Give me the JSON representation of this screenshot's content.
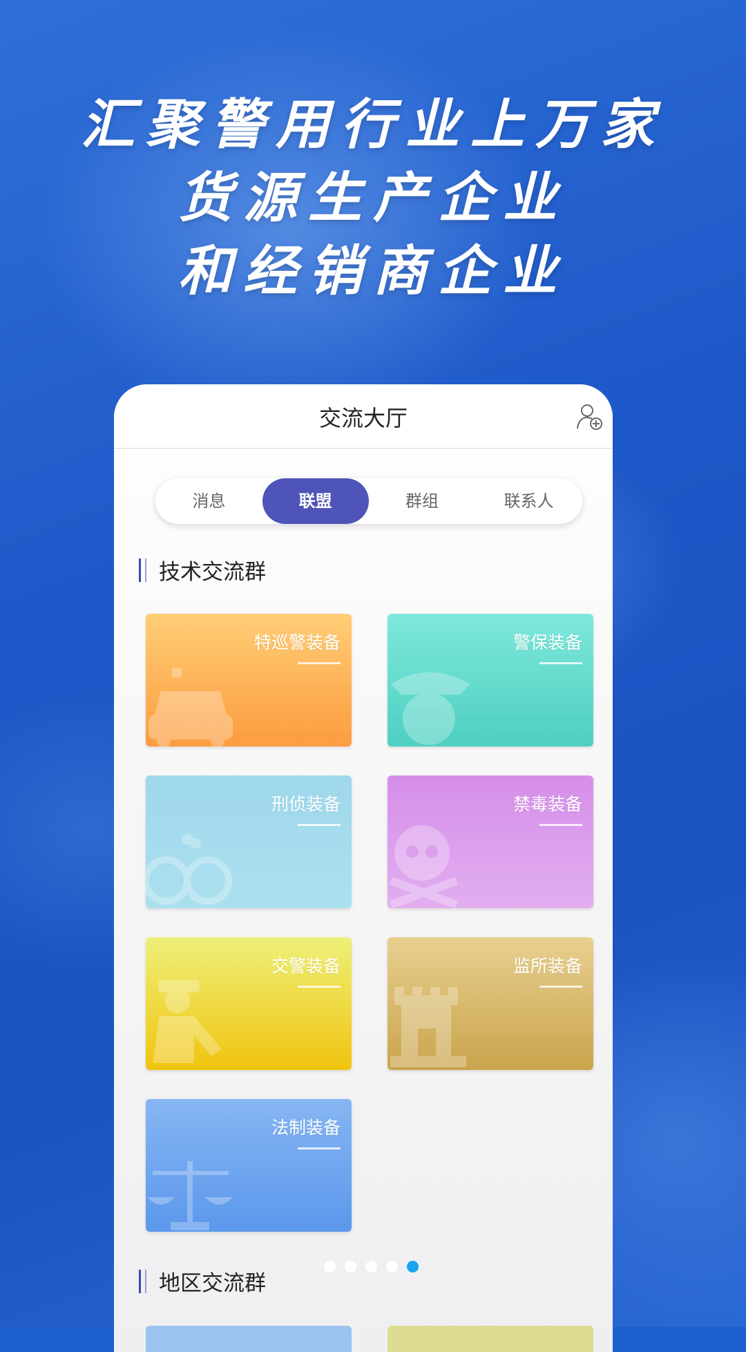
{
  "headline": {
    "line1": "汇聚警用行业上万家",
    "line2": "货源生产企业",
    "line3": "和经销商企业"
  },
  "nav": {
    "title": "交流大厅",
    "add_contact_icon": "add-contact-icon"
  },
  "tabs": [
    {
      "label": "消息",
      "active": false
    },
    {
      "label": "联盟",
      "active": true
    },
    {
      "label": "群组",
      "active": false
    },
    {
      "label": "联系人",
      "active": false
    }
  ],
  "sections": {
    "tech": "技术交流群",
    "region": "地区交流群"
  },
  "cards": [
    {
      "label": "特巡警装备",
      "icon": "police-car-icon",
      "colors": [
        "#ffce76",
        "#fd9c40"
      ]
    },
    {
      "label": "警保装备",
      "icon": "police-officer-icon",
      "colors": [
        "#7ee8dc",
        "#4ecfc0"
      ]
    },
    {
      "label": "刑侦装备",
      "icon": "handcuffs-icon",
      "colors": [
        "#9fd8ec",
        "#abe0ee"
      ]
    },
    {
      "label": "禁毒装备",
      "icon": "skull-crossbones-icon",
      "colors": [
        "#d58ee9",
        "#e2aef0"
      ]
    },
    {
      "label": "交警装备",
      "icon": "traffic-police-icon",
      "colors": [
        "#eef07a",
        "#f0c40e"
      ]
    },
    {
      "label": "监所装备",
      "icon": "prison-tower-icon",
      "colors": [
        "#e8cf90",
        "#c9a44c"
      ]
    },
    {
      "label": "法制装备",
      "icon": "scales-of-justice-icon",
      "colors": [
        "#86b6f2",
        "#5b97ec"
      ]
    }
  ],
  "pagination": {
    "total": 5,
    "active_index": 4,
    "active_color": "#1aa3ee"
  },
  "colors": {
    "accent": "#4e54b8",
    "background": "#1e5fd0"
  }
}
